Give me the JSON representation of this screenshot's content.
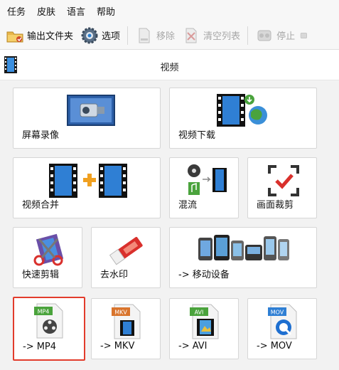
{
  "menu": [
    "任务",
    "皮肤",
    "语言",
    "帮助"
  ],
  "toolbar": {
    "output_folder": "输出文件夹",
    "options": "选项",
    "remove": "移除",
    "clear_list": "清空列表",
    "stop": "停止"
  },
  "section": {
    "title": "视频"
  },
  "tiles": {
    "screen_record": "屏幕录像",
    "video_download": "视频下载",
    "video_merge": "视频合并",
    "mix": "混流",
    "crop": "画面裁剪",
    "quick_edit": "快速剪辑",
    "watermark": "去水印",
    "mobile": "-> 移动设备",
    "mp4": "-> MP4",
    "mkv": "-> MKV",
    "avi": "-> AVI",
    "mov": "-> MOV"
  },
  "badges": {
    "mp4": "MP4",
    "mkv": "MKV",
    "avi": "AVI",
    "mov": "MOV"
  },
  "colors": {
    "selected_border": "#e23c2c",
    "film": "#1d4f8f",
    "accent_green": "#4aa33c"
  }
}
